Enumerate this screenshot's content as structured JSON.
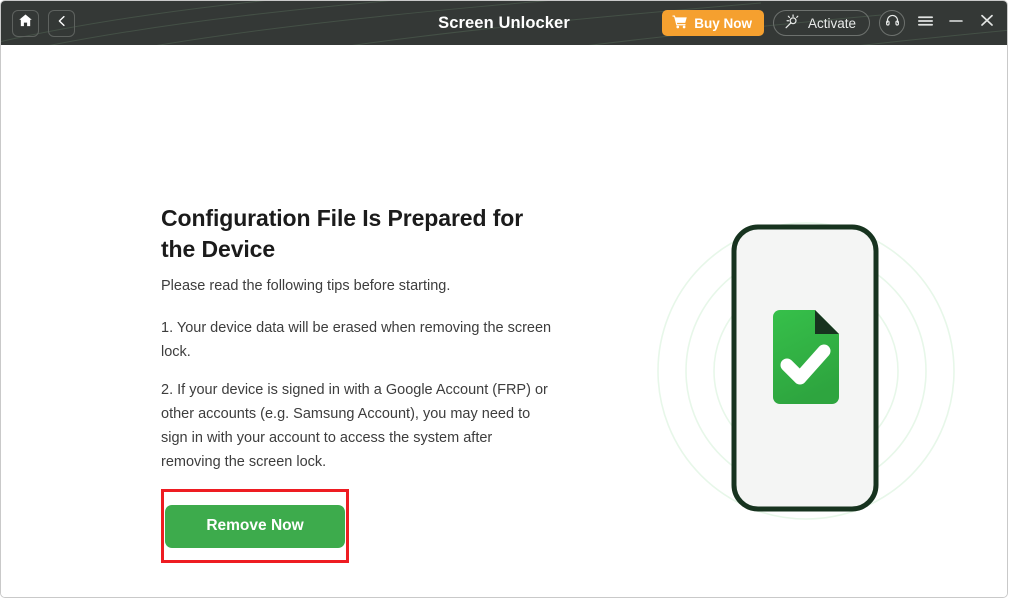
{
  "window": {
    "title": "Screen Unlocker"
  },
  "titlebar": {
    "home_label": "Home",
    "back_label": "Back",
    "buy_label": "Buy Now",
    "activate_label": "Activate",
    "support_label": "Support",
    "menu_label": "Menu",
    "minimize_label": "Minimize",
    "close_label": "Close",
    "icons": {
      "home": "home-icon",
      "back": "chevron-left-icon",
      "cart": "shopping-cart-icon",
      "activate": "magic-wand-icon",
      "support": "headset-icon",
      "menu": "hamburger-menu-icon",
      "minimize": "minimize-icon",
      "close": "close-icon"
    },
    "colors": {
      "background": "#343836",
      "buy_button": "#f5a02f",
      "text": "#ffffff"
    }
  },
  "main": {
    "headline": "Configuration File Is Prepared for the Device",
    "subtitle": "Please read the following tips before starting.",
    "tips": [
      "1. Your device data will be erased when removing the screen lock.",
      "2. If your device is signed in with a Google Account (FRP) or other accounts (e.g. Samsung Account), you may need to sign in with your account to access the system after removing the screen lock."
    ],
    "cta": {
      "label": "Remove Now",
      "color": "#3dab4c",
      "highlight_color": "#ee1c22"
    },
    "illustration": {
      "name": "phone-with-configuration-file-check",
      "phone_outline_color": "#17331f",
      "screen_color": "#f4f5f4",
      "document_color": "#36b44a",
      "check_color": "#ffffff",
      "ring_color": "#e7f7e9"
    }
  }
}
